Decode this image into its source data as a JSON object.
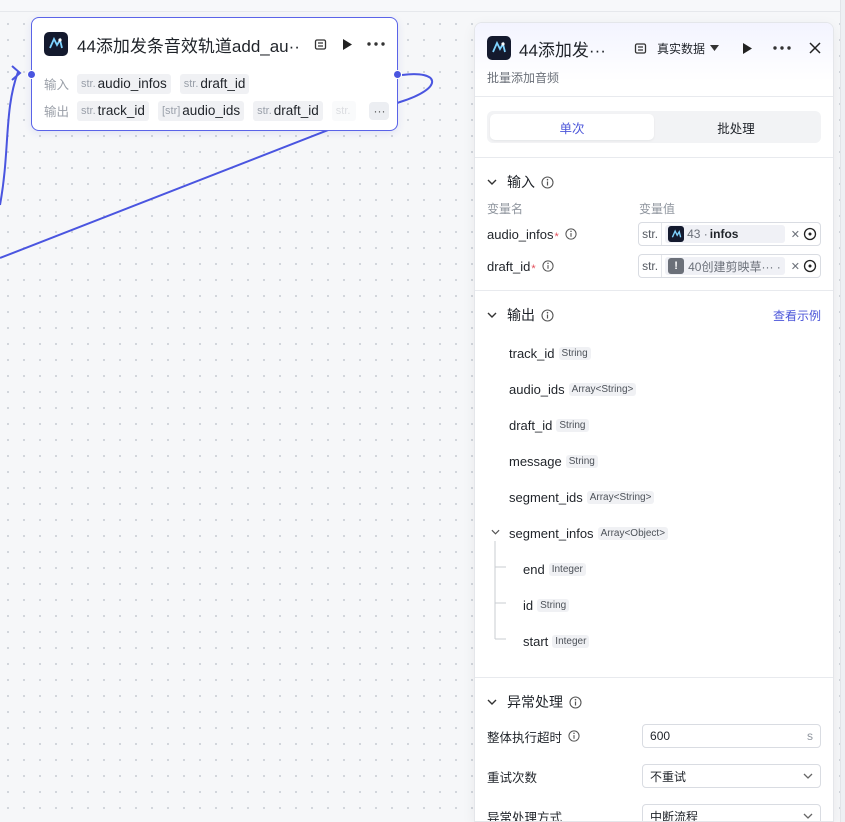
{
  "node": {
    "title": "44添加发条音效轨道add_au···",
    "input_label": "输入",
    "output_label": "输出",
    "inputs": [
      {
        "type": "str.",
        "name": "audio_infos"
      },
      {
        "type": "str.",
        "name": "draft_id"
      }
    ],
    "outputs": [
      {
        "type": "str.",
        "name": "track_id"
      },
      {
        "type": "[str]",
        "name": "audio_ids"
      },
      {
        "type": "str.",
        "name": "draft_id"
      },
      {
        "type": "str.",
        "name": ""
      }
    ]
  },
  "panel": {
    "title": "44添加发···",
    "data_select": "真实数据",
    "description": "批量添加音频",
    "tabs": [
      {
        "label": "单次",
        "active": true
      },
      {
        "label": "批处理",
        "active": false
      }
    ],
    "input_section": {
      "title": "输入",
      "col_name": "变量名",
      "col_value": "变量值",
      "rows": [
        {
          "name": "audio_infos",
          "type": "str.",
          "ref_prefix": "43 · ",
          "ref_field": "infos"
        },
        {
          "name": "draft_id",
          "type": "str.",
          "ref_prefix": "40创建剪映草··· · ",
          "ref_field": ""
        }
      ]
    },
    "output_section": {
      "title": "输出",
      "link": "查看示例",
      "fields": [
        {
          "name": "track_id",
          "type": "String"
        },
        {
          "name": "audio_ids",
          "type": "Array<String>"
        },
        {
          "name": "draft_id",
          "type": "String"
        },
        {
          "name": "message",
          "type": "String"
        },
        {
          "name": "segment_ids",
          "type": "Array<String>"
        },
        {
          "name": "segment_infos",
          "type": "Array<Object>"
        }
      ],
      "children": [
        {
          "name": "end",
          "type": "Integer"
        },
        {
          "name": "id",
          "type": "String"
        },
        {
          "name": "start",
          "type": "Integer"
        }
      ]
    },
    "exception_section": {
      "title": "异常处理",
      "timeout_label": "整体执行超时",
      "timeout_value": "600",
      "timeout_unit": "s",
      "retry_label": "重试次数",
      "retry_value": "不重试",
      "mode_label": "异常处理方式",
      "mode_value": "中断流程"
    }
  },
  "colors": {
    "accent": "#4b55d9",
    "edge": "#4a55e0",
    "required": "#e34d59"
  }
}
